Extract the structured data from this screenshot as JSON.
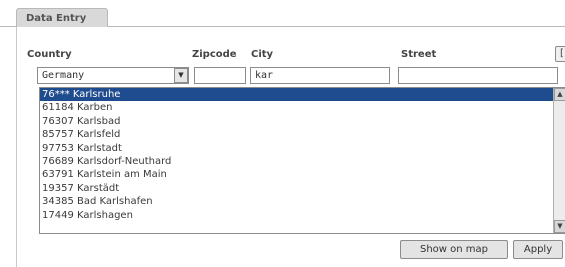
{
  "tab": {
    "label": "Data Entry"
  },
  "columns": {
    "country": "Country",
    "zipcode": "Zipcode",
    "city": "City",
    "street": "Street"
  },
  "fields": {
    "country_value": "Germany",
    "zipcode_value": "",
    "city_value": "kar",
    "street_value": ""
  },
  "cut_button_glyph": "[",
  "suggestions": [
    "76*** Karlsruhe",
    "61184 Karben",
    "76307 Karlsbad",
    "85757 Karlsfeld",
    "97753 Karlstadt",
    "76689 Karlsdorf-Neuthard",
    "63791 Karlstein am Main",
    "19357 Karstädt",
    "34385 Bad Karlshafen",
    "17449 Karlshagen"
  ],
  "buttons": {
    "show_on_map": "Show on map",
    "apply": "Apply"
  },
  "colors": {
    "selection": "#1f4b8f",
    "tab": "#d9d9d9",
    "border": "#8c8c8c"
  },
  "icons": {
    "select_arrow": "chevron-down-icon",
    "scroll_up": "scroll-up-icon",
    "scroll_down": "scroll-down-icon"
  }
}
